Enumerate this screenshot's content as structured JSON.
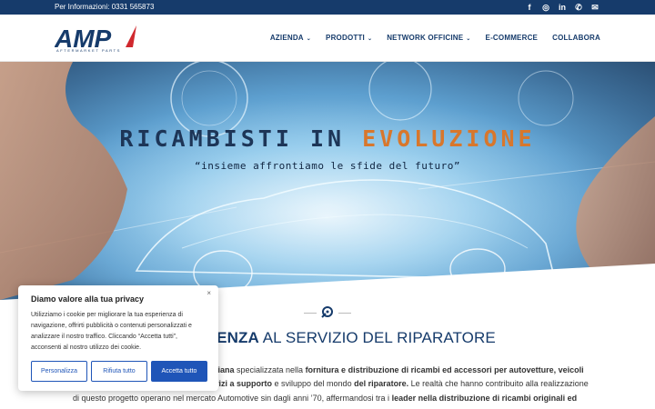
{
  "topbar": {
    "phone_text": "Per Informazioni: 0331 565873",
    "social_icons": [
      "facebook-icon",
      "instagram-icon",
      "linkedin-icon",
      "whatsapp-icon",
      "mail-icon"
    ],
    "social_glyphs": [
      "f",
      "◎",
      "in",
      "✆",
      "✉"
    ]
  },
  "header": {
    "logo_text": "AMP",
    "logo_tagline": "AFTERMARKET PARTS",
    "nav": [
      {
        "label": "AZIENDA",
        "has_dropdown": true
      },
      {
        "label": "PRODOTTI",
        "has_dropdown": true
      },
      {
        "label": "NETWORK OFFICINE",
        "has_dropdown": true
      },
      {
        "label": "E-COMMERCE",
        "has_dropdown": false
      },
      {
        "label": "COLLABORA",
        "has_dropdown": false
      }
    ],
    "chevron": "⌄"
  },
  "hero": {
    "title_part1": "RICAMBISTI IN ",
    "title_part2": "EVOLUZIONE",
    "subtitle": "“insieme affrontiamo le sfide del futuro”"
  },
  "section": {
    "title_bold": "ESPERIENZA",
    "title_rest": " AL SERVIZIO DEL RIPARATORE",
    "line1_a": "aliana",
    "line1_b": " specializzata nella ",
    "line1_c": "fornitura e distribuzione di ricambi ed accessori per autovetture, veicoli",
    "line2_a": "rvizi a supporto",
    "line2_b": " e sviluppo del mondo ",
    "line2_c": "del riparatore.",
    "line2_d": " Le realtà che hanno contribuito alla realizzazione",
    "line3_a": "di questo progetto operano nel mercato Automotive sin dagli anni ’70, affermandosi tra i ",
    "line3_b": "leader nella distribuzione di ricambi originali ed"
  },
  "cookie": {
    "title": "Diamo valore alla tua privacy",
    "text": "Utilizziamo i cookie per migliorare la tua esperienza di navigazione, offrirti pubblicità o contenuti personalizzati e analizzare il nostro traffico. Cliccando “Accetta tutti”, acconsenti al nostro utilizzo dei cookie.",
    "close": "×",
    "btn_customize": "Personalizza",
    "btn_reject": "Rifiuta tutto",
    "btn_accept": "Accetta tutto"
  },
  "colors": {
    "brand_navy": "#163b6b",
    "accent_red": "#d0282e",
    "accent_orange": "#d8772c",
    "button_blue": "#1f55b8"
  }
}
